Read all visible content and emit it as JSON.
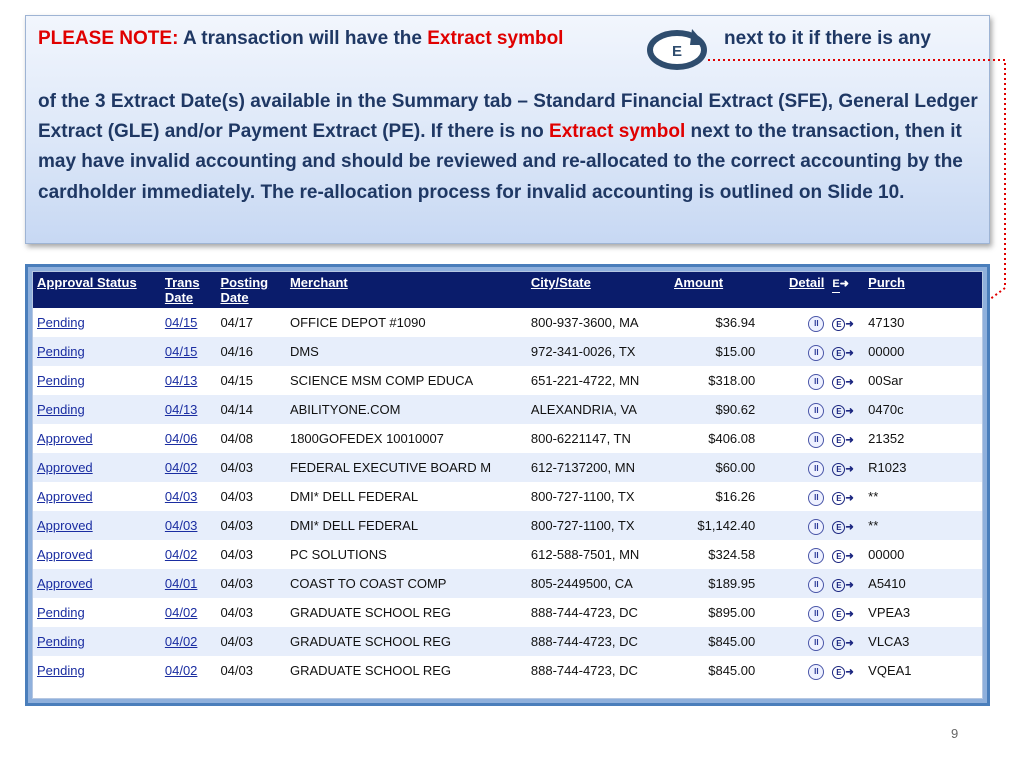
{
  "note": {
    "label": "PLEASE NOTE:",
    "line1_text": "A transaction will have the",
    "extract_symbol_1": "Extract symbol",
    "line1_after": "next to it if there is any",
    "body_part1": "of the 3 Extract Date(s) available in the Summary tab – Standard Financial Extract (SFE), General Ledger Extract (GLE) and/or Payment Extract (PE).  If there is no ",
    "extract_symbol_2": "Extract symbol",
    "body_part2": " next to the transaction, then it may have invalid accounting and should be reviewed and re-allocated to the correct accounting by the cardholder immediately.   The re-allocation process  for invalid accounting is outlined on Slide 10.",
    "logo_letter": "E"
  },
  "table": {
    "headers": {
      "approval_status": "Approval Status",
      "trans_date": "Trans Date",
      "posting_date": "Posting Date",
      "merchant": "Merchant",
      "city_state": "City/State",
      "amount": "Amount",
      "detail": "Detail",
      "extract": "E",
      "purchase": "Purch"
    },
    "rows": [
      {
        "status": "Pending",
        "trans": "04/15",
        "posting": "04/17",
        "merchant": "OFFICE DEPOT #1090",
        "city": "800-937-3600, MA",
        "amount": "$36.94",
        "purch": "47130"
      },
      {
        "status": "Pending",
        "trans": "04/15",
        "posting": "04/16",
        "merchant": "DMS",
        "city": "972-341-0026, TX",
        "amount": "$15.00",
        "purch": "00000"
      },
      {
        "status": "Pending",
        "trans": "04/13",
        "posting": "04/15",
        "merchant": "SCIENCE MSM COMP EDUCA",
        "city": "651-221-4722, MN",
        "amount": "$318.00",
        "purch": "00Sar"
      },
      {
        "status": "Pending",
        "trans": "04/13",
        "posting": "04/14",
        "merchant": "ABILITYONE.COM",
        "city": "ALEXANDRIA, VA",
        "amount": "$90.62",
        "purch": "0470c"
      },
      {
        "status": "Approved",
        "trans": "04/06",
        "posting": "04/08",
        "merchant": "1800GOFEDEX 10010007",
        "city": "800-6221147, TN",
        "amount": "$406.08",
        "purch": "21352"
      },
      {
        "status": "Approved",
        "trans": "04/02",
        "posting": "04/03",
        "merchant": "FEDERAL EXECUTIVE BOARD M",
        "city": "612-7137200, MN",
        "amount": "$60.00",
        "purch": "R1023"
      },
      {
        "status": "Approved",
        "trans": "04/03",
        "posting": "04/03",
        "merchant": "DMI* DELL FEDERAL",
        "city": "800-727-1100, TX",
        "amount": "$16.26",
        "purch": "**"
      },
      {
        "status": "Approved",
        "trans": "04/03",
        "posting": "04/03",
        "merchant": "DMI* DELL FEDERAL",
        "city": "800-727-1100, TX",
        "amount": "$1,142.40",
        "purch": "**"
      },
      {
        "status": "Approved",
        "trans": "04/02",
        "posting": "04/03",
        "merchant": "PC SOLUTIONS",
        "city": "612-588-7501, MN",
        "amount": "$324.58",
        "purch": "00000"
      },
      {
        "status": "Approved",
        "trans": "04/01",
        "posting": "04/03",
        "merchant": "COAST TO COAST COMP",
        "city": "805-2449500, CA",
        "amount": "$189.95",
        "purch": "A5410"
      },
      {
        "status": "Pending",
        "trans": "04/02",
        "posting": "04/03",
        "merchant": "GRADUATE SCHOOL REG",
        "city": "888-744-4723, DC",
        "amount": "$895.00",
        "purch": "VPEA3"
      },
      {
        "status": "Pending",
        "trans": "04/02",
        "posting": "04/03",
        "merchant": "GRADUATE SCHOOL REG",
        "city": "888-744-4723, DC",
        "amount": "$845.00",
        "purch": "VLCA3"
      },
      {
        "status": "Pending",
        "trans": "04/02",
        "posting": "04/03",
        "merchant": "GRADUATE SCHOOL REG",
        "city": "888-744-4723, DC",
        "amount": "$845.00",
        "purch": "VQEA1"
      }
    ]
  },
  "icons": {
    "detail": "detail-circle-icon",
    "extract": "extract-e-arrow-icon"
  },
  "colors": {
    "emphasis_red": "#e00000",
    "body_text": "#1f3864",
    "table_header_bg": "#0a1c6b",
    "link": "#1a2da1"
  },
  "page_number": "9"
}
